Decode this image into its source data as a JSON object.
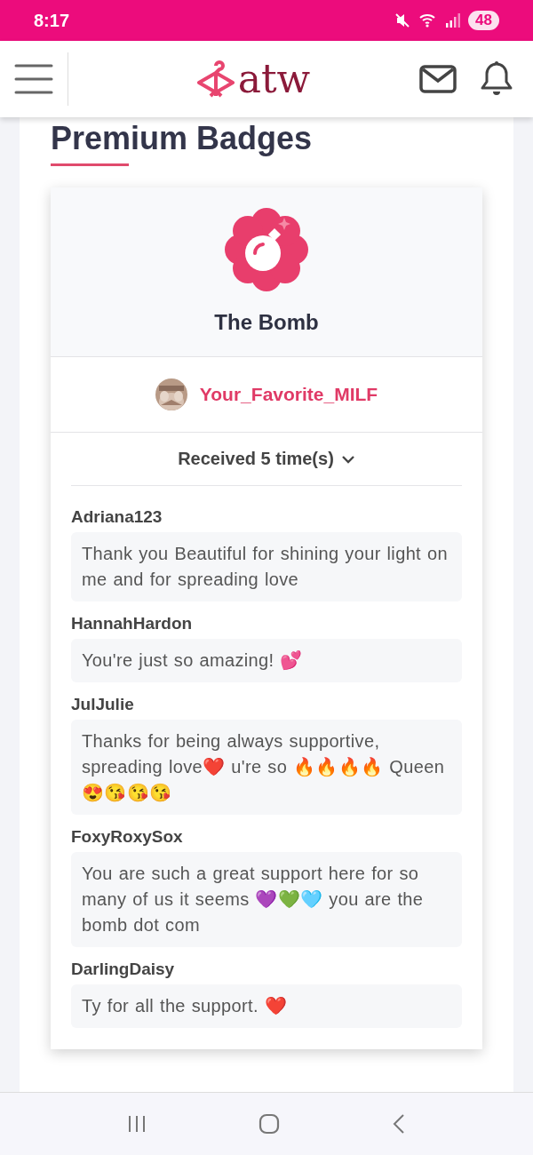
{
  "status_bar": {
    "time": "8:17",
    "battery": "48"
  },
  "header": {
    "logo": "atw"
  },
  "section": {
    "title": "Premium Badges"
  },
  "badge": {
    "name": "The Bomb",
    "owner": "Your_Favorite_MILF",
    "received": "Received 5 time(s)",
    "expanded": true
  },
  "comments": [
    {
      "author": "Adriana123",
      "message": "Thank you Beautiful for shining your light on me and for spreading love"
    },
    {
      "author": "HannahHardon",
      "message": "You're just so amazing! 💕"
    },
    {
      "author": "JulJulie",
      "message": "Thanks for being always supportive, spreading love❤️ u're so 🔥🔥🔥🔥 Queen 😍😘😘😘"
    },
    {
      "author": "FoxyRoxySox",
      "message": "You are such a great support here for so many of us it seems 💜💚🩵 you are the bomb dot com"
    },
    {
      "author": "DarlingDaisy",
      "message": "Ty for all the support. ❤️"
    }
  ]
}
